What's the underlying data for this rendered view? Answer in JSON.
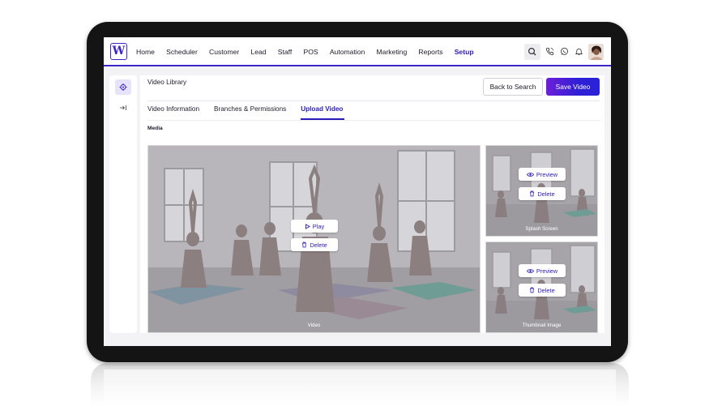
{
  "nav": {
    "logo": "W",
    "items": [
      {
        "label": "Home",
        "active": false
      },
      {
        "label": "Scheduler",
        "active": false
      },
      {
        "label": "Customer",
        "active": false
      },
      {
        "label": "Lead",
        "active": false
      },
      {
        "label": "Staff",
        "active": false
      },
      {
        "label": "POS",
        "active": false
      },
      {
        "label": "Automation",
        "active": false
      },
      {
        "label": "Marketing",
        "active": false
      },
      {
        "label": "Reports",
        "active": false
      },
      {
        "label": "Setup",
        "active": true
      }
    ],
    "icons": [
      "search-icon",
      "phone-icon",
      "whatsapp-icon",
      "bell-icon"
    ]
  },
  "sidebar": {
    "icons": [
      "gear-icon",
      "collapse-icon"
    ]
  },
  "page": {
    "title": "Video Library",
    "back_label": "Back to Search",
    "save_label": "Save Video"
  },
  "tabs": [
    {
      "label": "Video Information",
      "active": false
    },
    {
      "label": "Branches & Permissions",
      "active": false
    },
    {
      "label": "Upload Video",
      "active": true
    }
  ],
  "media": {
    "section_label": "Media",
    "video": {
      "caption": "Video",
      "play_label": "Play",
      "delete_label": "Delete"
    },
    "splash": {
      "caption": "Splash Screen",
      "preview_label": "Preview",
      "delete_label": "Delete"
    },
    "thumbnail": {
      "caption": "Thumbnail Image",
      "preview_label": "Preview",
      "delete_label": "Delete"
    }
  },
  "colors": {
    "accent": "#2a1bb8",
    "nav_border": "#3b27c9",
    "save_gradient_start": "#6d1fd8",
    "save_gradient_end": "#2a22d8"
  }
}
